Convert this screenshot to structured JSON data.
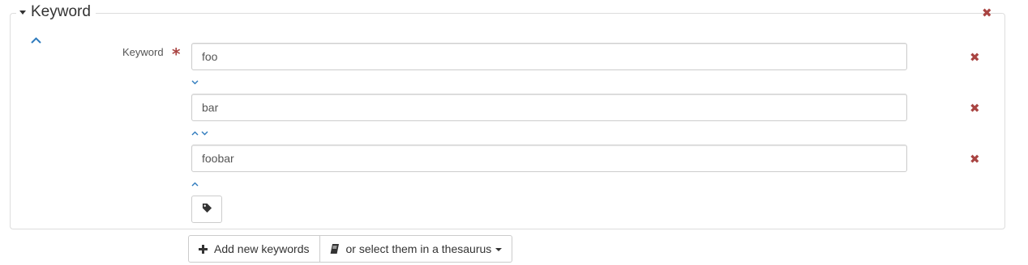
{
  "section": {
    "title": "Keyword",
    "collapse_icon": "caret-down-icon",
    "remove_icon": "remove-icon"
  },
  "field": {
    "label": "Keyword",
    "required_mark": "*"
  },
  "keywords": [
    {
      "value": "foo"
    },
    {
      "value": "bar"
    },
    {
      "value": "foobar"
    }
  ],
  "tag_button": {
    "icon": "tag-icon"
  },
  "actions": {
    "add_new_label": "Add new keywords",
    "add_new_icon": "plus-icon",
    "thesaurus_label": "or select them in a thesaurus",
    "thesaurus_icon": "book-icon"
  },
  "colors": {
    "remove": "#a94442",
    "arrow": "#2f7bbd",
    "border": "#cccccc"
  }
}
